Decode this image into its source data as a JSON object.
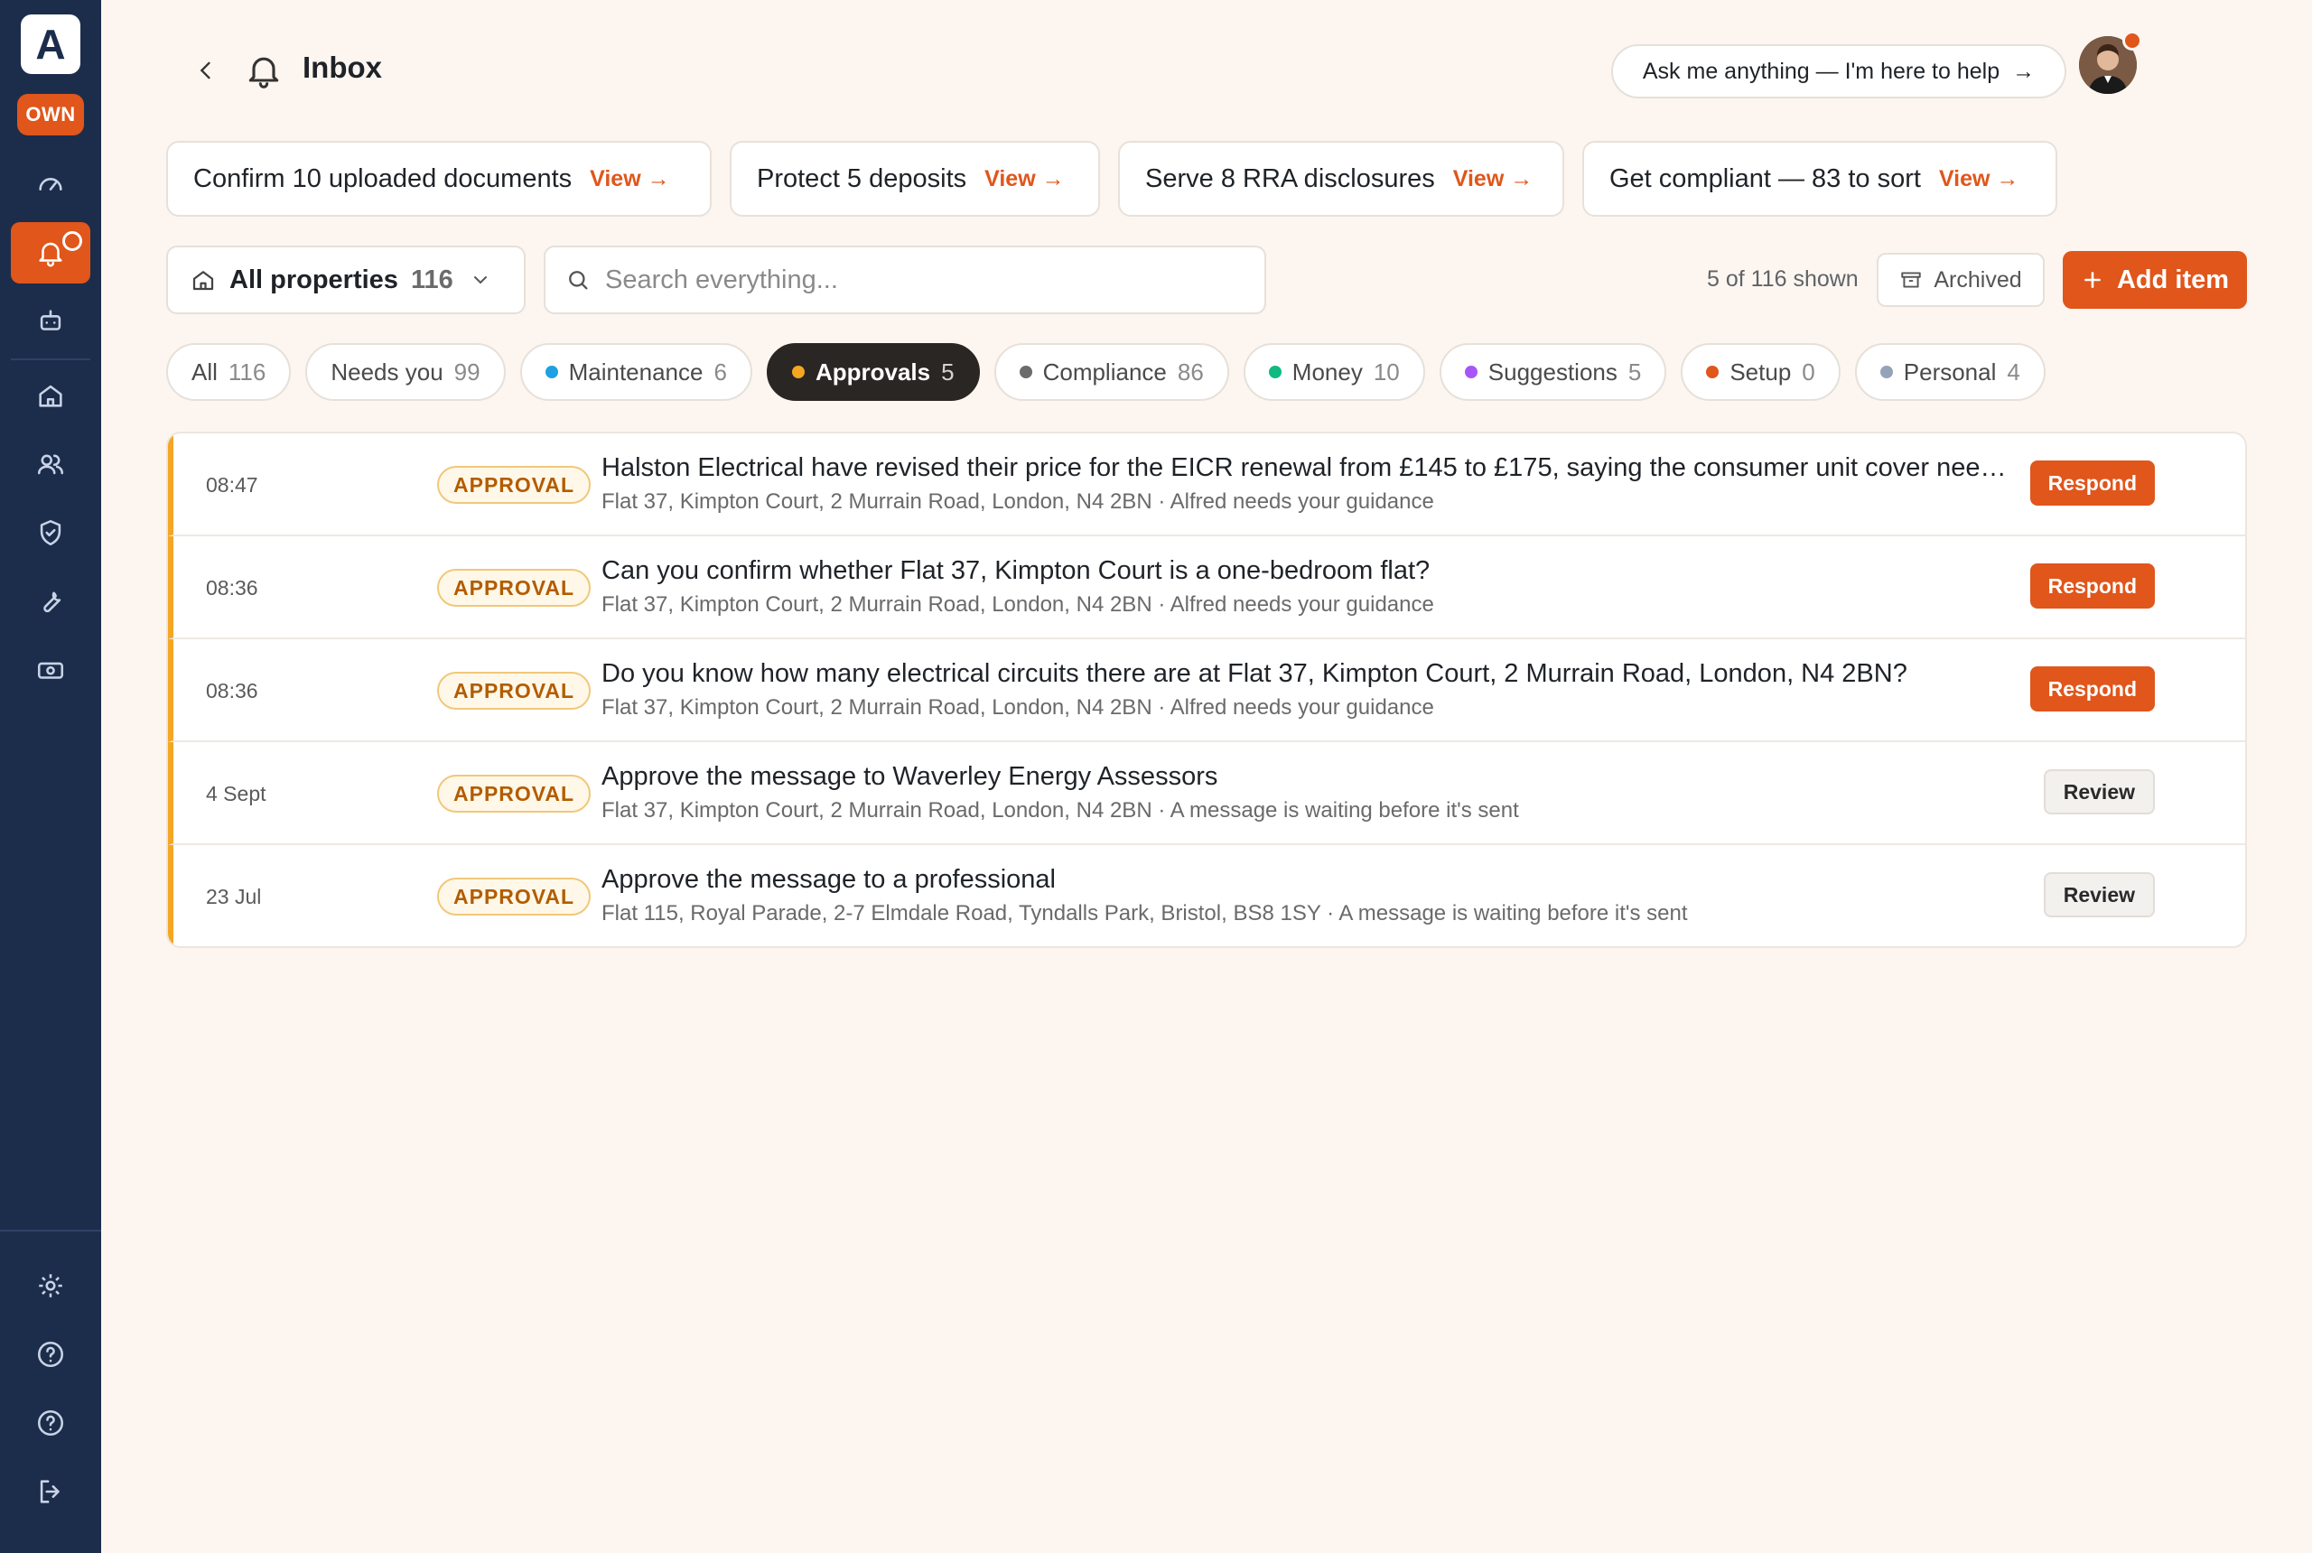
{
  "brand": {
    "logo_letter": "A",
    "mode_badge": "OWN",
    "accent": "#e0561b",
    "sidebar_bg": "#1c2d4c"
  },
  "sidebar": {
    "items": [
      {
        "name": "dashboard-icon"
      },
      {
        "name": "inbox-bell-icon",
        "active": true
      },
      {
        "name": "robot-icon"
      },
      {
        "name": "home-icon"
      },
      {
        "name": "people-icon"
      },
      {
        "name": "shield-check-icon"
      },
      {
        "name": "wrench-icon"
      },
      {
        "name": "money-icon"
      }
    ],
    "bottom": [
      {
        "name": "gear-icon"
      },
      {
        "name": "help-icon"
      },
      {
        "name": "help-icon"
      },
      {
        "name": "logout-icon"
      }
    ]
  },
  "header": {
    "title": "Inbox",
    "ask_prompt": "Ask me anything — I'm here to help",
    "ask_arrow": "→"
  },
  "summary_cards": [
    {
      "label": "Confirm 10 uploaded documents",
      "link": "View →"
    },
    {
      "label": "Protect 5 deposits",
      "link": "View →"
    },
    {
      "label": "Serve 8 RRA disclosures",
      "link": "View →"
    },
    {
      "label": "Get compliant — 83 to sort",
      "link": "View →"
    }
  ],
  "filters": {
    "property_label": "All properties",
    "property_count": "116",
    "search_placeholder": "Search everything...",
    "shown": "5 of 116 shown",
    "archived_label": "Archived",
    "add_label": "Add item"
  },
  "tabs": [
    {
      "label": "All",
      "count": "116",
      "dot": ""
    },
    {
      "label": "Needs you",
      "count": "99",
      "dot": ""
    },
    {
      "label": "Maintenance",
      "count": "6",
      "dot": "#1da1e2"
    },
    {
      "label": "Approvals",
      "count": "5",
      "dot": "#f5a623",
      "active": true
    },
    {
      "label": "Compliance",
      "count": "86",
      "dot": "#6b6b6b"
    },
    {
      "label": "Money",
      "count": "10",
      "dot": "#10b981"
    },
    {
      "label": "Suggestions",
      "count": "5",
      "dot": "#a855f7"
    },
    {
      "label": "Setup",
      "count": "0",
      "dot": "#e0561b"
    },
    {
      "label": "Personal",
      "count": "4",
      "dot": "#94a3b8"
    }
  ],
  "rows": [
    {
      "time": "08:47",
      "badge": "APPROVAL",
      "title": "Halston Electrical have revised their price for the EICR renewal from £145 to £175, saying the consumer unit cover needs replacing",
      "sub": "Flat 37, Kimpton Court, 2 Murrain Road, London, N4 2BN · Alfred needs your guidance",
      "action": "Respond",
      "kind": "respond"
    },
    {
      "time": "08:36",
      "badge": "APPROVAL",
      "title": "Can you confirm whether Flat 37, Kimpton Court is a one-bedroom flat?",
      "sub": "Flat 37, Kimpton Court, 2 Murrain Road, London, N4 2BN · Alfred needs your guidance",
      "action": "Respond",
      "kind": "respond"
    },
    {
      "time": "08:36",
      "badge": "APPROVAL",
      "title": "Do you know how many electrical circuits there are at Flat 37, Kimpton Court, 2 Murrain Road, London, N4 2BN?",
      "sub": "Flat 37, Kimpton Court, 2 Murrain Road, London, N4 2BN · Alfred needs your guidance",
      "action": "Respond",
      "kind": "respond"
    },
    {
      "time": "4 Sept",
      "badge": "APPROVAL",
      "title": "Approve the message to Waverley Energy Assessors",
      "sub": "Flat 37, Kimpton Court, 2 Murrain Road, London, N4 2BN · A message is waiting before it's sent",
      "action": "Review",
      "kind": "review"
    },
    {
      "time": "23 Jul",
      "badge": "APPROVAL",
      "title": "Approve the message to a professional",
      "sub": "Flat 115, Royal Parade, 2-7 Elmdale Road, Tyndalls Park, Bristol, BS8 1SY · A message is waiting before it's sent",
      "action": "Review",
      "kind": "review"
    }
  ]
}
